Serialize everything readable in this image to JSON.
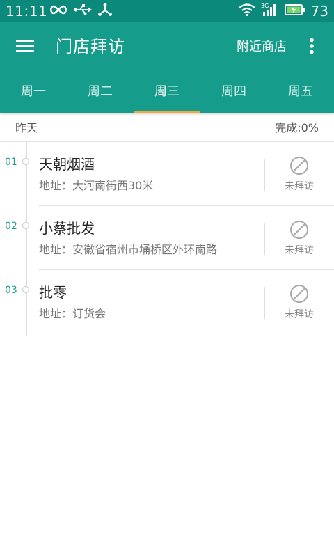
{
  "status_bar": {
    "time": "11:11",
    "battery_level": "73",
    "icons": [
      "infinity-icon",
      "usb-icon",
      "share-icon",
      "wifi-icon",
      "signal-3g-icon",
      "battery-charging-icon"
    ]
  },
  "app_bar": {
    "title": "门店拜访",
    "nearby_label": "附近商店",
    "icons": [
      "menu-icon",
      "more-vert-icon"
    ]
  },
  "tabs": [
    {
      "label": "周一",
      "active": false
    },
    {
      "label": "周二",
      "active": false
    },
    {
      "label": "周三",
      "active": true
    },
    {
      "label": "周四",
      "active": false
    },
    {
      "label": "周五",
      "active": false
    }
  ],
  "summary": {
    "day": "昨天",
    "progress": "完成:0%"
  },
  "visits": [
    {
      "index": "01",
      "name": "天朝烟酒",
      "address": "地址：大河南街西30米",
      "status": "未拜访",
      "status_icon": "not-visited-icon"
    },
    {
      "index": "02",
      "name": "小蔡批发",
      "address": "地址：安徽省宿州市埇桥区外环南路",
      "status": "未拜访",
      "status_icon": "not-visited-icon"
    },
    {
      "index": "03",
      "name": "批零",
      "address": "地址：订货会",
      "status": "未拜访",
      "status_icon": "not-visited-icon"
    }
  ],
  "colors": {
    "status_bar": "#0b8a7c",
    "primary": "#159c8b",
    "tab_indicator": "#f2a640",
    "index_text": "#159c8b"
  }
}
